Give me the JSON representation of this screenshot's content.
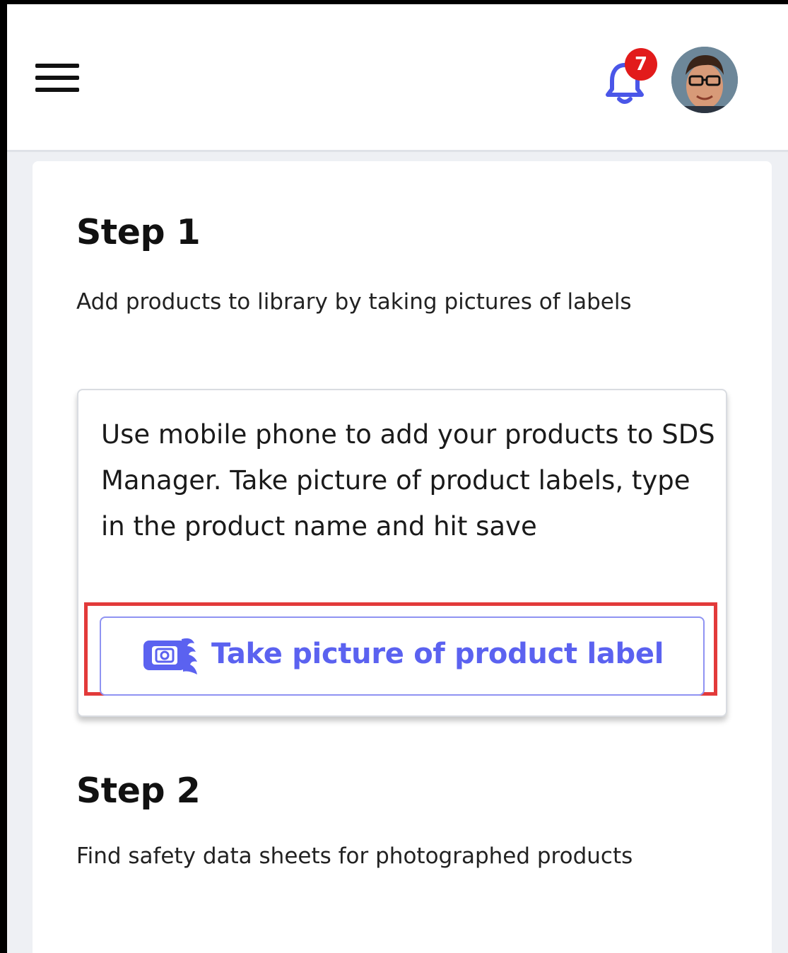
{
  "header": {
    "menu_icon": "hamburger-menu-icon",
    "notifications": {
      "icon": "bell-icon",
      "count": "7",
      "color": "#4a56e8",
      "badge_color": "#e21b1b"
    },
    "avatar": "user-avatar"
  },
  "step1": {
    "title": "Step 1",
    "description": "Add products to library by taking pictures of labels",
    "info_text": "Use mobile phone to add your products to SDS Manager. Take picture of product labels, type in the product name and hit save",
    "button_label": "Take picture of product label",
    "button_icon": "camera-phone-icon",
    "accent_color": "#5b62f0",
    "highlight_color": "#e23a3a"
  },
  "step2": {
    "title": "Step 2",
    "description": "Find safety data sheets for photographed products"
  }
}
